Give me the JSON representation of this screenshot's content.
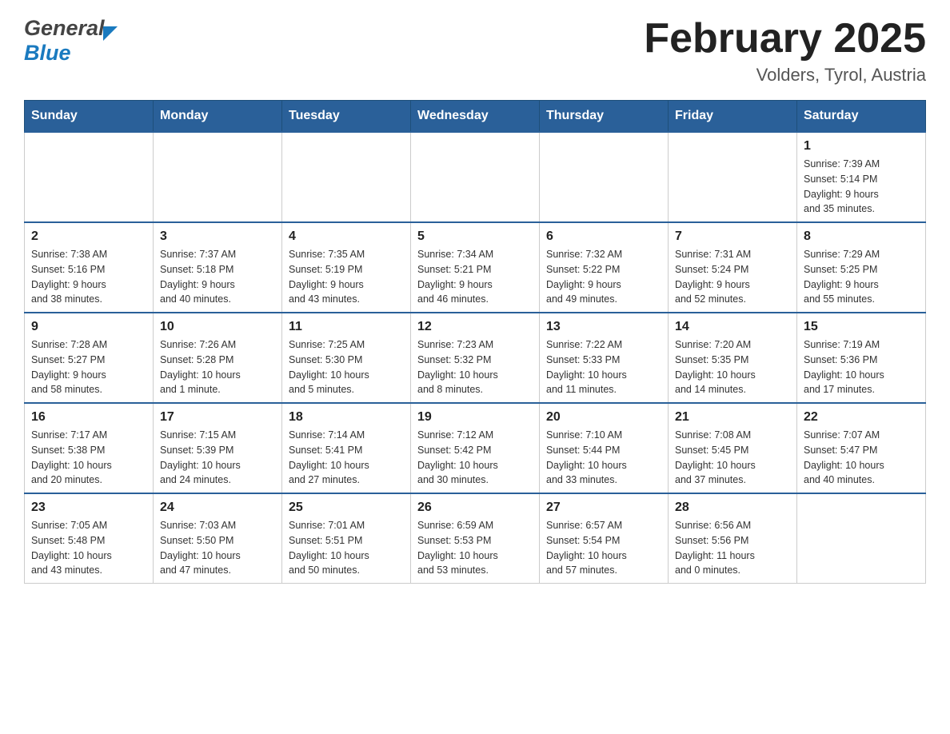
{
  "header": {
    "logo_general": "General",
    "logo_blue": "Blue",
    "title": "February 2025",
    "subtitle": "Volders, Tyrol, Austria"
  },
  "weekdays": [
    "Sunday",
    "Monday",
    "Tuesday",
    "Wednesday",
    "Thursday",
    "Friday",
    "Saturday"
  ],
  "weeks": [
    [
      {
        "day": "",
        "info": ""
      },
      {
        "day": "",
        "info": ""
      },
      {
        "day": "",
        "info": ""
      },
      {
        "day": "",
        "info": ""
      },
      {
        "day": "",
        "info": ""
      },
      {
        "day": "",
        "info": ""
      },
      {
        "day": "1",
        "info": "Sunrise: 7:39 AM\nSunset: 5:14 PM\nDaylight: 9 hours\nand 35 minutes."
      }
    ],
    [
      {
        "day": "2",
        "info": "Sunrise: 7:38 AM\nSunset: 5:16 PM\nDaylight: 9 hours\nand 38 minutes."
      },
      {
        "day": "3",
        "info": "Sunrise: 7:37 AM\nSunset: 5:18 PM\nDaylight: 9 hours\nand 40 minutes."
      },
      {
        "day": "4",
        "info": "Sunrise: 7:35 AM\nSunset: 5:19 PM\nDaylight: 9 hours\nand 43 minutes."
      },
      {
        "day": "5",
        "info": "Sunrise: 7:34 AM\nSunset: 5:21 PM\nDaylight: 9 hours\nand 46 minutes."
      },
      {
        "day": "6",
        "info": "Sunrise: 7:32 AM\nSunset: 5:22 PM\nDaylight: 9 hours\nand 49 minutes."
      },
      {
        "day": "7",
        "info": "Sunrise: 7:31 AM\nSunset: 5:24 PM\nDaylight: 9 hours\nand 52 minutes."
      },
      {
        "day": "8",
        "info": "Sunrise: 7:29 AM\nSunset: 5:25 PM\nDaylight: 9 hours\nand 55 minutes."
      }
    ],
    [
      {
        "day": "9",
        "info": "Sunrise: 7:28 AM\nSunset: 5:27 PM\nDaylight: 9 hours\nand 58 minutes."
      },
      {
        "day": "10",
        "info": "Sunrise: 7:26 AM\nSunset: 5:28 PM\nDaylight: 10 hours\nand 1 minute."
      },
      {
        "day": "11",
        "info": "Sunrise: 7:25 AM\nSunset: 5:30 PM\nDaylight: 10 hours\nand 5 minutes."
      },
      {
        "day": "12",
        "info": "Sunrise: 7:23 AM\nSunset: 5:32 PM\nDaylight: 10 hours\nand 8 minutes."
      },
      {
        "day": "13",
        "info": "Sunrise: 7:22 AM\nSunset: 5:33 PM\nDaylight: 10 hours\nand 11 minutes."
      },
      {
        "day": "14",
        "info": "Sunrise: 7:20 AM\nSunset: 5:35 PM\nDaylight: 10 hours\nand 14 minutes."
      },
      {
        "day": "15",
        "info": "Sunrise: 7:19 AM\nSunset: 5:36 PM\nDaylight: 10 hours\nand 17 minutes."
      }
    ],
    [
      {
        "day": "16",
        "info": "Sunrise: 7:17 AM\nSunset: 5:38 PM\nDaylight: 10 hours\nand 20 minutes."
      },
      {
        "day": "17",
        "info": "Sunrise: 7:15 AM\nSunset: 5:39 PM\nDaylight: 10 hours\nand 24 minutes."
      },
      {
        "day": "18",
        "info": "Sunrise: 7:14 AM\nSunset: 5:41 PM\nDaylight: 10 hours\nand 27 minutes."
      },
      {
        "day": "19",
        "info": "Sunrise: 7:12 AM\nSunset: 5:42 PM\nDaylight: 10 hours\nand 30 minutes."
      },
      {
        "day": "20",
        "info": "Sunrise: 7:10 AM\nSunset: 5:44 PM\nDaylight: 10 hours\nand 33 minutes."
      },
      {
        "day": "21",
        "info": "Sunrise: 7:08 AM\nSunset: 5:45 PM\nDaylight: 10 hours\nand 37 minutes."
      },
      {
        "day": "22",
        "info": "Sunrise: 7:07 AM\nSunset: 5:47 PM\nDaylight: 10 hours\nand 40 minutes."
      }
    ],
    [
      {
        "day": "23",
        "info": "Sunrise: 7:05 AM\nSunset: 5:48 PM\nDaylight: 10 hours\nand 43 minutes."
      },
      {
        "day": "24",
        "info": "Sunrise: 7:03 AM\nSunset: 5:50 PM\nDaylight: 10 hours\nand 47 minutes."
      },
      {
        "day": "25",
        "info": "Sunrise: 7:01 AM\nSunset: 5:51 PM\nDaylight: 10 hours\nand 50 minutes."
      },
      {
        "day": "26",
        "info": "Sunrise: 6:59 AM\nSunset: 5:53 PM\nDaylight: 10 hours\nand 53 minutes."
      },
      {
        "day": "27",
        "info": "Sunrise: 6:57 AM\nSunset: 5:54 PM\nDaylight: 10 hours\nand 57 minutes."
      },
      {
        "day": "28",
        "info": "Sunrise: 6:56 AM\nSunset: 5:56 PM\nDaylight: 11 hours\nand 0 minutes."
      },
      {
        "day": "",
        "info": ""
      }
    ]
  ]
}
